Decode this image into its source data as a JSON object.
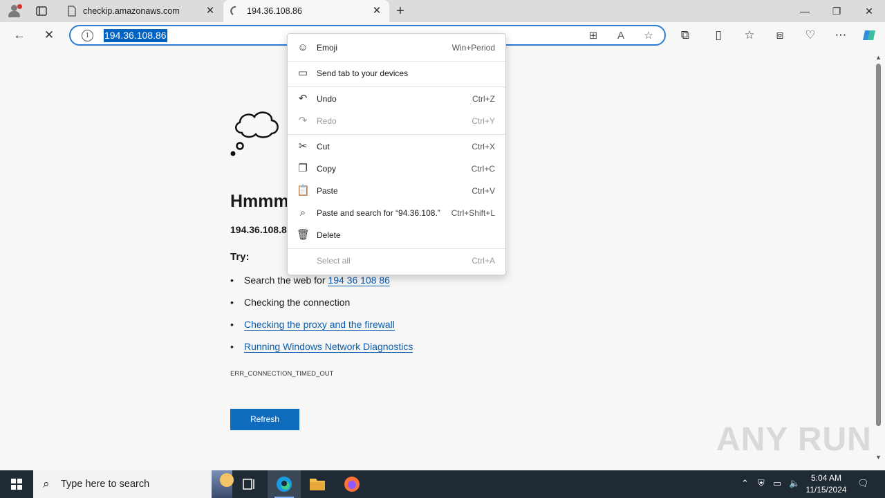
{
  "browser": {
    "tabs": [
      {
        "title": "checkip.amazonaws.com"
      },
      {
        "title": "194.36.108.86"
      }
    ],
    "address": {
      "url": "194.36.108.86"
    }
  },
  "page": {
    "heading": "Hmmm",
    "subhead": "194.36.108.8",
    "try_label": "Try:",
    "suggestions": {
      "search_prefix": "Search the web for",
      "search_link": "194 36 108 86",
      "checking_connection": "Checking the connection",
      "proxy_firewall": "Checking the proxy and the firewall",
      "network_diagnostics": "Running Windows Network Diagnostics"
    },
    "error_code": "ERR_CONNECTION_TIMED_OUT",
    "refresh_label": "Refresh"
  },
  "context_menu": {
    "items": [
      {
        "label": "Emoji",
        "shortcut": "Win+Period",
        "icon": "emoji-icon"
      },
      {
        "label": "Send tab to your devices",
        "shortcut": "",
        "icon": "send-tab-icon"
      },
      {
        "label": "Undo",
        "shortcut": "Ctrl+Z",
        "icon": "undo-icon"
      },
      {
        "label": "Redo",
        "shortcut": "Ctrl+Y",
        "icon": "redo-icon",
        "disabled": true
      },
      {
        "label": "Cut",
        "shortcut": "Ctrl+X",
        "icon": "cut-icon"
      },
      {
        "label": "Copy",
        "shortcut": "Ctrl+C",
        "icon": "copy-icon"
      },
      {
        "label": "Paste",
        "shortcut": "Ctrl+V",
        "icon": "paste-icon"
      },
      {
        "label": "Paste and search for “94.36.108.”",
        "shortcut": "Ctrl+Shift+L",
        "icon": "paste-search-icon"
      },
      {
        "label": "Delete",
        "shortcut": "",
        "icon": "delete-icon"
      },
      {
        "label": "Select all",
        "shortcut": "Ctrl+A",
        "icon": "",
        "disabled": true
      }
    ]
  },
  "watermark": "ANY RUN",
  "taskbar": {
    "search_placeholder": "Type here to search",
    "time": "5:04 AM",
    "date": "11/15/2024"
  },
  "colors": {
    "accent": "#0f6cbd",
    "link": "#0b5cad",
    "address_border": "#2b7bd4",
    "taskbar": "#1f2a35"
  }
}
